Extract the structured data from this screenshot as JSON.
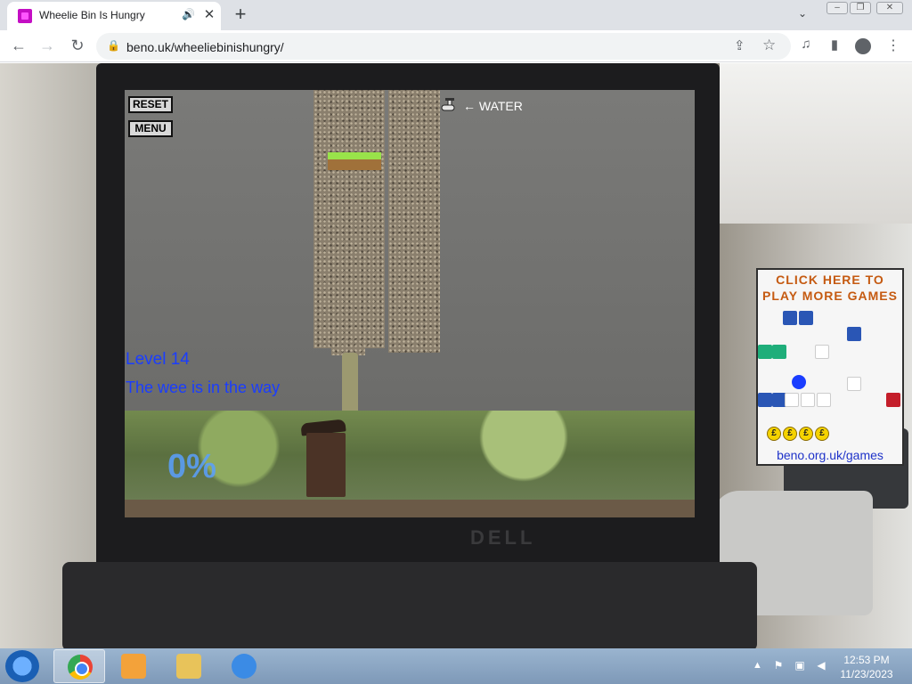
{
  "browser": {
    "tab_title": "Wheelie Bin Is Hungry",
    "url": "beno.uk/wheeliebinishungry/",
    "icons": [
      "favicon-icon",
      "audio-icon",
      "close-icon",
      "new-tab-icon",
      "tab-search-icon",
      "back-icon",
      "forward-icon",
      "reload-icon",
      "lock-icon",
      "share-icon",
      "star-icon",
      "media-icon",
      "side-panel-icon",
      "profile-icon",
      "kebab-icon"
    ]
  },
  "game": {
    "reset_label": "RESET",
    "menu_label": "MENU",
    "water_label": "WATER",
    "level_label": "Level 14",
    "level_hint": "The wee is in the way",
    "progress_percent": "0%",
    "colors": {
      "level_text": "#1a3dff",
      "progress_text": "#5aa0ff",
      "platform_grass": "#99e34a",
      "platform_dirt": "#a0713a"
    }
  },
  "ad": {
    "title_line1": "CLICK HERE TO",
    "title_line2": "PLAY MORE GAMES",
    "coin_symbol": "£",
    "url": "beno.org.uk/games",
    "title_color": "#c55a11"
  },
  "taskbar": {
    "apps": [
      "chrome",
      "media-player",
      "file-explorer",
      "internet-explorer"
    ],
    "clock_time": "12:53 PM",
    "clock_date": "11/23/2023"
  }
}
